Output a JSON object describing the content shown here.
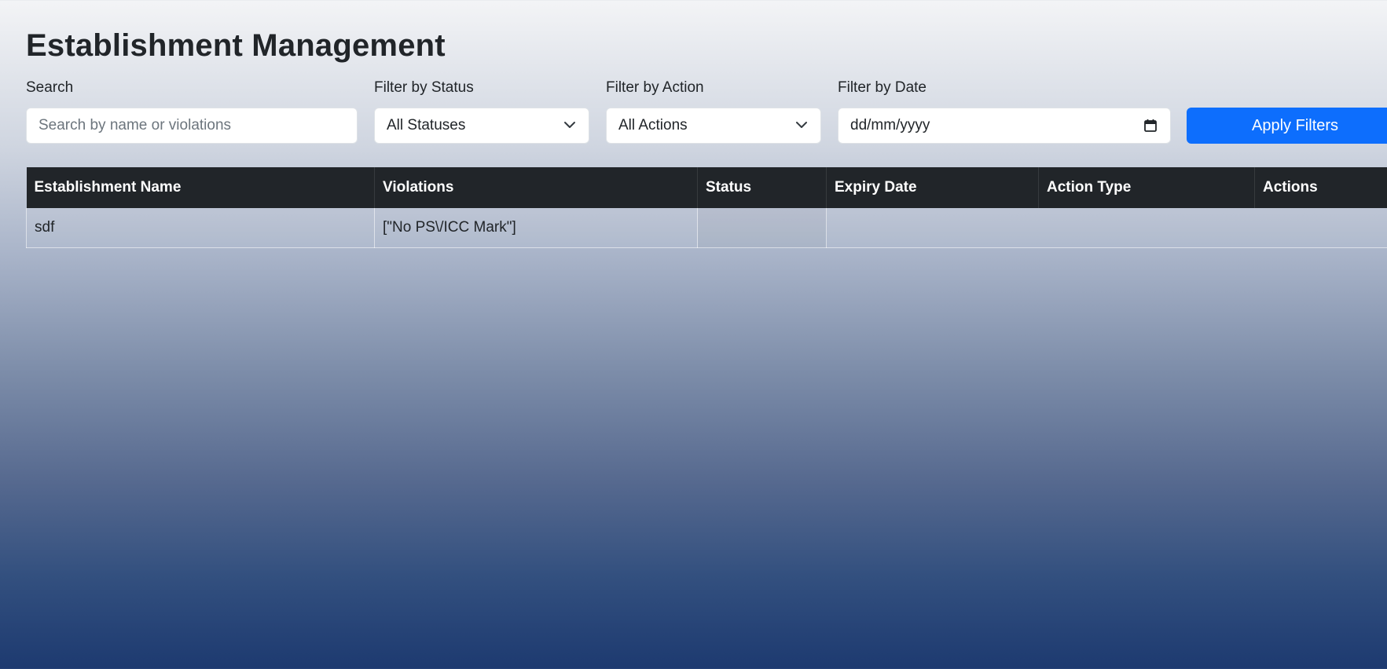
{
  "page": {
    "title": "Establishment Management"
  },
  "filters": {
    "search": {
      "label": "Search",
      "placeholder": "Search by name or violations",
      "value": ""
    },
    "status": {
      "label": "Filter by Status",
      "selected": "All Statuses"
    },
    "action": {
      "label": "Filter by Action",
      "selected": "All Actions"
    },
    "date": {
      "label": "Filter by Date",
      "placeholder": "dd/mm/yyyy"
    },
    "apply_label": "Apply Filters"
  },
  "table": {
    "headers": [
      "Establishment Name",
      "Violations",
      "Status",
      "Expiry Date",
      "Action Type",
      "Actions"
    ],
    "rows": [
      {
        "name": "sdf",
        "violations": "[\"No PS\\/ICC Mark\"]",
        "status": "",
        "expiry_date": "",
        "action_type": "",
        "actions": ""
      }
    ]
  },
  "colors": {
    "primary": "#0d6efd",
    "table_header_bg": "#212529",
    "gradient_top": "#f3f4f6",
    "gradient_bottom": "#1d3a70"
  },
  "icons": {
    "status_select": "chevron-down-icon",
    "action_select": "chevron-down-icon",
    "date_picker": "calendar-icon"
  }
}
